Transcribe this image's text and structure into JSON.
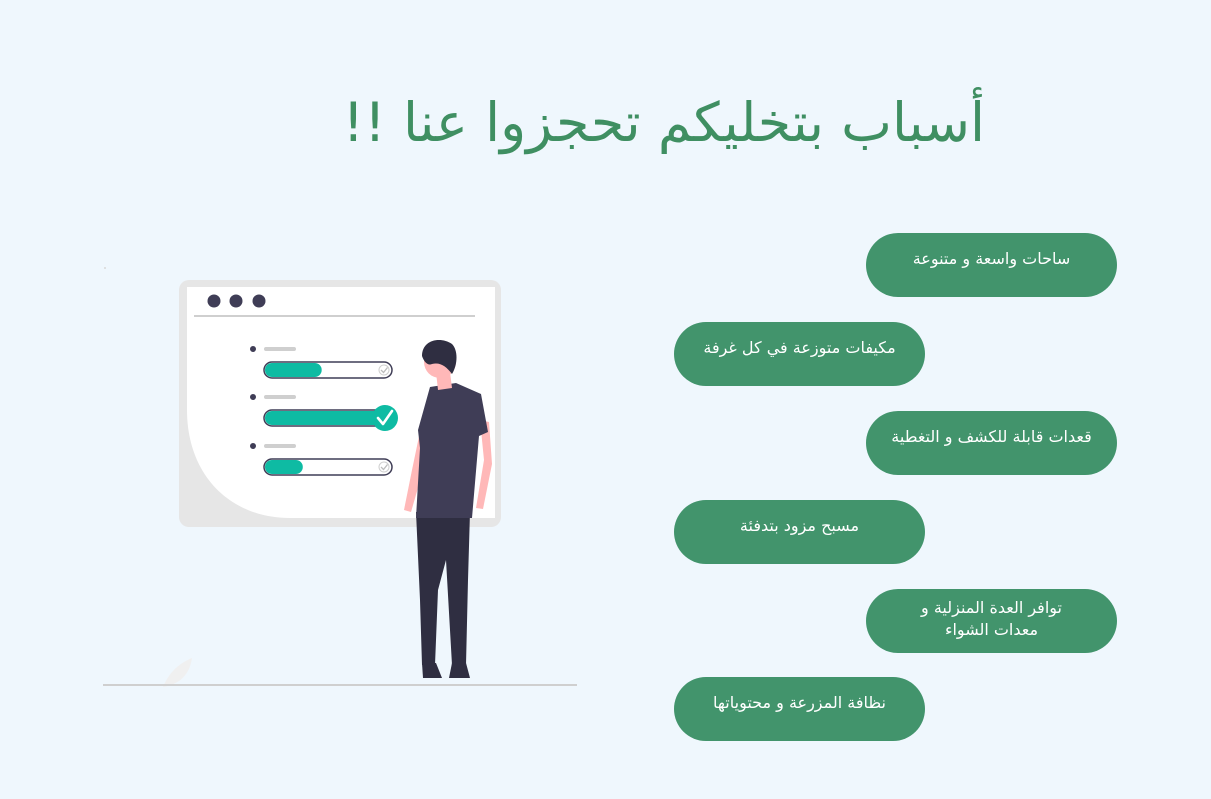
{
  "heading": {
    "title": "أسباب بتخليكم تحجزوا عنا !!"
  },
  "features": [
    {
      "label": "ساحات واسعة و متنوعة"
    },
    {
      "label": "مكيفات متوزعة في كل غرفة"
    },
    {
      "label": "قعدات قابلة للكشف و التغطية"
    },
    {
      "label": "مسبح مزود بتدفئة"
    },
    {
      "label": "توافر العدة المنزلية و\nمعدات الشواء"
    },
    {
      "label": "نظافة المزرعة و محتوياتها"
    }
  ],
  "colors": {
    "background": "#eff7fd",
    "accent": "#42946c",
    "title": "#3f8f62",
    "progress": "#0ebba3",
    "figure": "#3f3d56"
  },
  "illustration": {
    "icon": "checklist-illustration",
    "progress_levels": [
      0.45,
      1.0,
      0.3
    ]
  }
}
